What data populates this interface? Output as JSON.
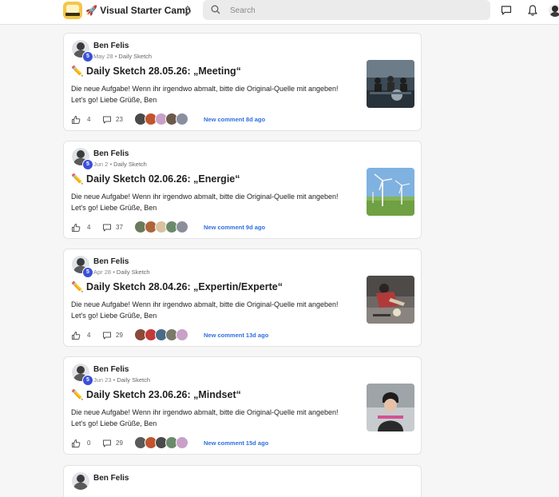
{
  "header": {
    "community_name": "🚀 Visual Starter Camp",
    "search_placeholder": "Search"
  },
  "posts": [
    {
      "author": "Ben Felis",
      "level": "5",
      "date": "May 28",
      "category": "Daily Sketch",
      "title": "✏️ Daily Sketch 28.05.26: „Meeting“",
      "excerpt": "Die neue Aufgabe! Wenn ihr irgendwo abmalt, bitte die Original-Quelle mit angeben! Let's go! Liebe Grüße, Ben",
      "likes": "4",
      "comments": "23",
      "new_comment": "New comment 8d ago",
      "avatar_colors": [
        "#4a4a4a",
        "#c0552f",
        "#c9a0c7",
        "#6b5a4a",
        "#8a8fa0"
      ],
      "thumb": "meeting"
    },
    {
      "author": "Ben Felis",
      "level": "5",
      "date": "Jun 2",
      "category": "Daily Sketch",
      "title": "✏️ Daily Sketch 02.06.26: „Energie“",
      "excerpt": "Die neue Aufgabe! Wenn ihr irgendwo abmalt, bitte die Original-Quelle mit angeben! Let's go! Liebe Grüße, Ben",
      "likes": "4",
      "comments": "37",
      "new_comment": "New comment 9d ago",
      "avatar_colors": [
        "#6a7a5a",
        "#b0643a",
        "#d8c2a0",
        "#6b8a6b",
        "#8a8f9a"
      ],
      "thumb": "energie"
    },
    {
      "author": "Ben Felis",
      "level": "5",
      "date": "Apr 28",
      "category": "Daily Sketch",
      "title": "✏️ Daily Sketch 28.04.26: „Expertin/Experte“",
      "excerpt": "Die neue Aufgabe! Wenn ihr irgendwo abmalt, bitte die Original-Quelle mit angeben! Let's go! Liebe Grüße, Ben",
      "likes": "4",
      "comments": "29",
      "new_comment": "New comment 13d ago",
      "avatar_colors": [
        "#8a4a3a",
        "#c23a3a",
        "#4a6a8a",
        "#7a7a6a",
        "#c9a0c7"
      ],
      "thumb": "expertin"
    },
    {
      "author": "Ben Felis",
      "level": "5",
      "date": "Jun 23",
      "category": "Daily Sketch",
      "title": "✏️ Daily Sketch 23.06.26: „Mindset“",
      "excerpt": "Die neue Aufgabe! Wenn ihr irgendwo abmalt, bitte die Original-Quelle mit angeben! Let's go! Liebe Grüße, Ben",
      "likes": "0",
      "comments": "29",
      "new_comment": "New comment 15d ago",
      "avatar_colors": [
        "#5a5a5a",
        "#c0552f",
        "#4a4a4a",
        "#6b8a6b",
        "#c9a0c7"
      ],
      "thumb": "mindset"
    }
  ],
  "partial_post": {
    "author": "Ben Felis"
  }
}
